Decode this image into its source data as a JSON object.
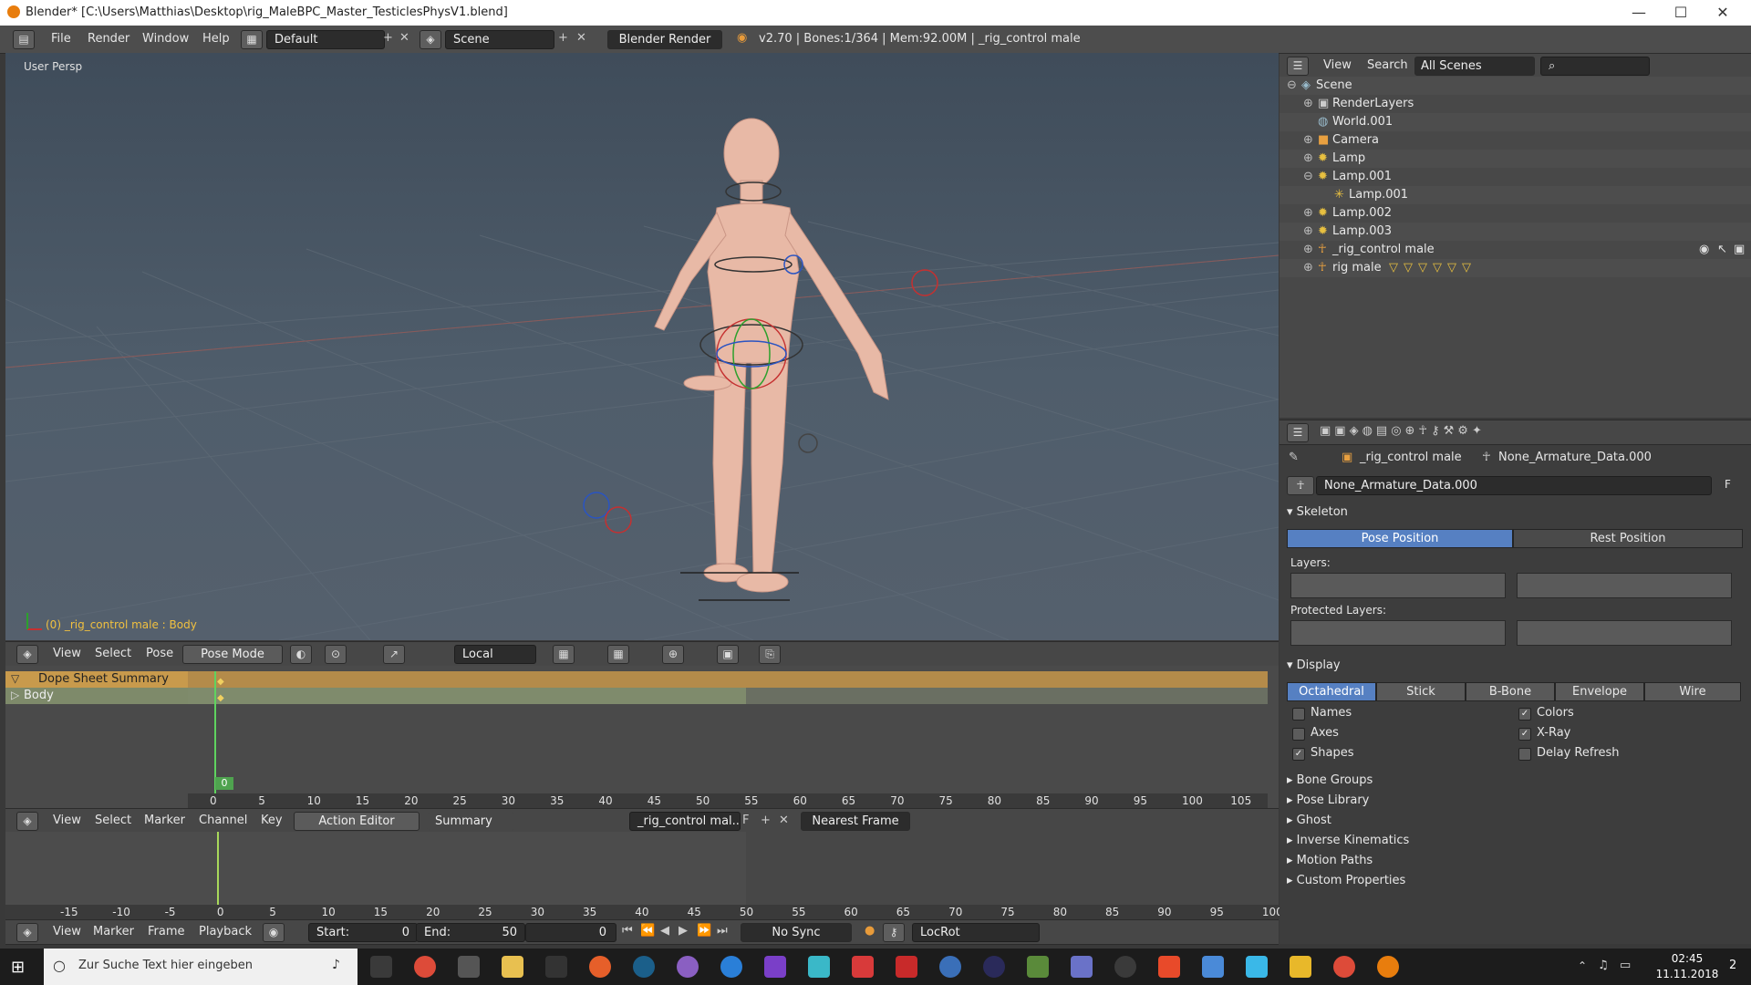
{
  "window": {
    "title": "Blender* [C:\\Users\\Matthias\\Desktop\\rig_MaleBPC_Master_TesticlesPhysV1.blend]",
    "minimize": "—",
    "maximize": "☐",
    "close": "✕"
  },
  "info_header": {
    "menus": [
      "File",
      "Render",
      "Window",
      "Help"
    ],
    "layout": "Default",
    "scene": "Scene",
    "engine": "Blender Render",
    "stats": "v2.70 | Bones:1/364  | Mem:92.00M | _rig_control male"
  },
  "viewport": {
    "label": "User Persp",
    "status": "(0) _rig_control male : Body"
  },
  "view3d_header": {
    "menus": [
      "View",
      "Select",
      "Pose"
    ],
    "mode": "Pose Mode",
    "orientation": "Local"
  },
  "outliner": {
    "menus": [
      "View",
      "Search"
    ],
    "scope": "All Scenes",
    "items": [
      {
        "label": "Scene"
      },
      {
        "label": "RenderLayers"
      },
      {
        "label": "World.001"
      },
      {
        "label": "Camera"
      },
      {
        "label": "Lamp"
      },
      {
        "label": "Lamp.001"
      },
      {
        "label": "Lamp.001"
      },
      {
        "label": "Lamp.002"
      },
      {
        "label": "Lamp.003"
      },
      {
        "label": "_rig_control male"
      },
      {
        "label": "rig male"
      }
    ]
  },
  "properties": {
    "breadcrumb_object": "_rig_control male",
    "breadcrumb_data": "None_Armature_Data.000",
    "datablock": "None_Armature_Data.000",
    "datablock_fake": "F",
    "skeleton": {
      "title": "Skeleton",
      "pose_position": "Pose Position",
      "rest_position": "Rest Position",
      "layers_label": "Layers:",
      "protected_label": "Protected Layers:"
    },
    "display": {
      "title": "Display",
      "types": [
        "Octahedral",
        "Stick",
        "B-Bone",
        "Envelope",
        "Wire"
      ],
      "active_type": "Octahedral",
      "names": "Names",
      "axes": "Axes",
      "shapes": "Shapes",
      "colors": "Colors",
      "xray": "X-Ray",
      "delay_refresh": "Delay Refresh"
    },
    "collapsed_panels": [
      "Bone Groups",
      "Pose Library",
      "Ghost",
      "Inverse Kinematics",
      "Motion Paths",
      "Custom Properties"
    ]
  },
  "dopesheet": {
    "channels": [
      "Dope Sheet Summary",
      "Body"
    ],
    "current_frame": "0",
    "ticks": [
      "0",
      "5",
      "10",
      "15",
      "20",
      "25",
      "30",
      "35",
      "40",
      "45",
      "50",
      "55",
      "60",
      "65",
      "70",
      "75",
      "80",
      "85",
      "90",
      "95",
      "100",
      "105"
    ]
  },
  "dope_header": {
    "menus": [
      "View",
      "Select",
      "Marker",
      "Channel",
      "Key"
    ],
    "mode": "Action Editor",
    "summary": "Summary",
    "action": "_rig_control mal...",
    "fake": "F",
    "snap": "Nearest Frame"
  },
  "timeline": {
    "ticks": [
      "-15",
      "-10",
      "-5",
      "0",
      "5",
      "10",
      "15",
      "20",
      "25",
      "30",
      "35",
      "40",
      "45",
      "50",
      "55",
      "60",
      "65",
      "70",
      "75",
      "80",
      "85",
      "90",
      "95",
      "100"
    ]
  },
  "timeline_header": {
    "menus": [
      "View",
      "Marker",
      "Frame",
      "Playback"
    ],
    "start_label": "Start:",
    "start_value": "0",
    "end_label": "End:",
    "end_value": "50",
    "current": "0",
    "sync": "No Sync",
    "keying_set": "LocRot"
  },
  "taskbar": {
    "search_placeholder": "Zur Suche Text hier eingeben",
    "time": "02:45",
    "date": "11.11.2018",
    "notification_count": "2"
  },
  "colors": {
    "accent_blue": "#5680c2",
    "summary_orange": "#c89a4c",
    "viewport_top": "#3f4c5a"
  }
}
